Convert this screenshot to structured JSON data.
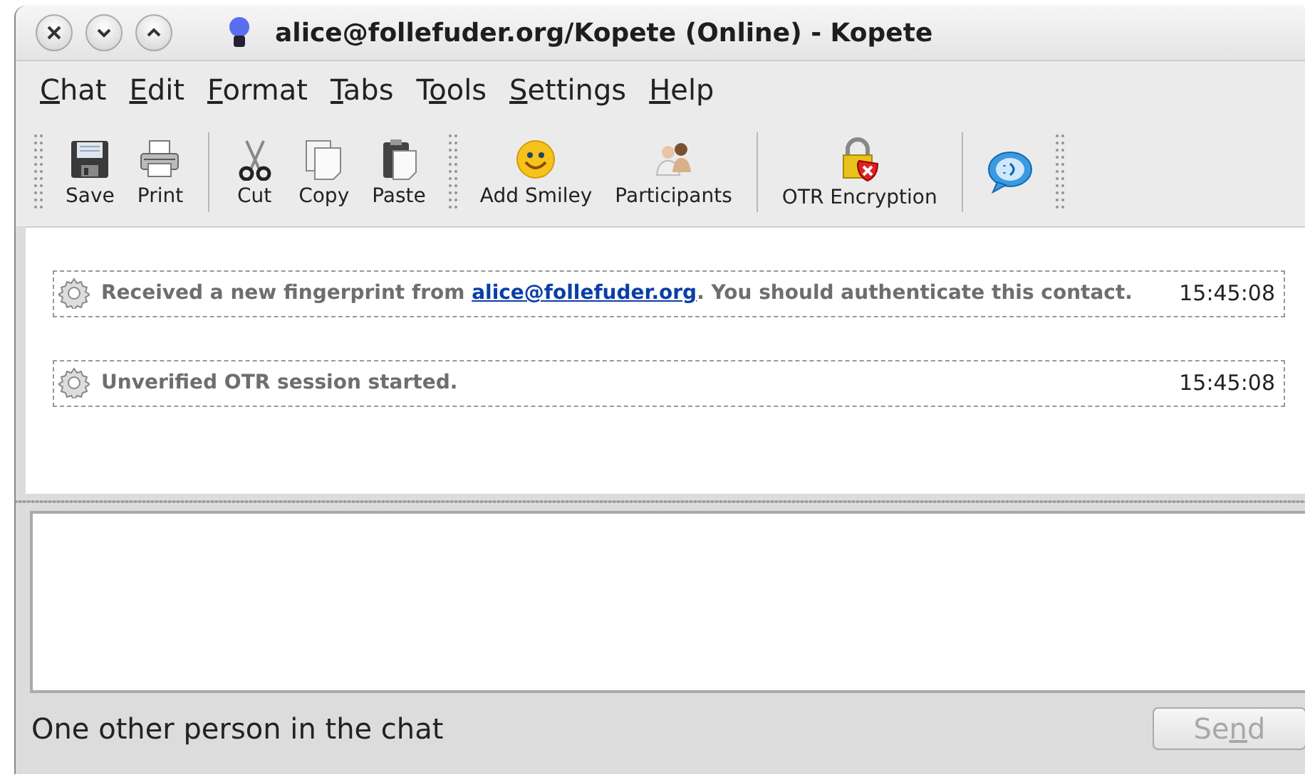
{
  "window": {
    "title": "alice@follefuder.org/Kopete (Online) - Kopete"
  },
  "menu": [
    {
      "key": "C",
      "after": "hat"
    },
    {
      "key": "E",
      "after": "dit"
    },
    {
      "key": "F",
      "after": "ormat"
    },
    {
      "key": "T",
      "after": "abs"
    },
    {
      "before": "T",
      "key": "o",
      "after": "ols"
    },
    {
      "key": "S",
      "after": "ettings"
    },
    {
      "key": "H",
      "after": "elp"
    }
  ],
  "toolbar": [
    {
      "kind": "handle"
    },
    {
      "kind": "button",
      "label": "Save"
    },
    {
      "kind": "button",
      "label": "Print"
    },
    {
      "kind": "separator"
    },
    {
      "kind": "button",
      "label": "Cut"
    },
    {
      "kind": "button",
      "label": "Copy"
    },
    {
      "kind": "button",
      "label": "Paste"
    },
    {
      "kind": "handle"
    },
    {
      "kind": "button",
      "label": "Add Smiley"
    },
    {
      "kind": "button",
      "label": "Participants"
    },
    {
      "kind": "separator"
    },
    {
      "kind": "button",
      "label": "OTR Encryption"
    },
    {
      "kind": "separator"
    },
    {
      "kind": "button"
    },
    {
      "kind": "handle"
    }
  ],
  "messages": [
    {
      "text": "Received a new fingerprint from ",
      "link": "alice@follefuder.org",
      "after": ". You should authenticate this contact.",
      "time": "15:45:08"
    },
    {
      "text": "Unverified OTR session started.",
      "time": "15:45:08"
    }
  ],
  "status": "One other person in the chat",
  "send_button": {
    "before": "Se",
    "key": "n",
    "after": "d",
    "disabled": true
  }
}
